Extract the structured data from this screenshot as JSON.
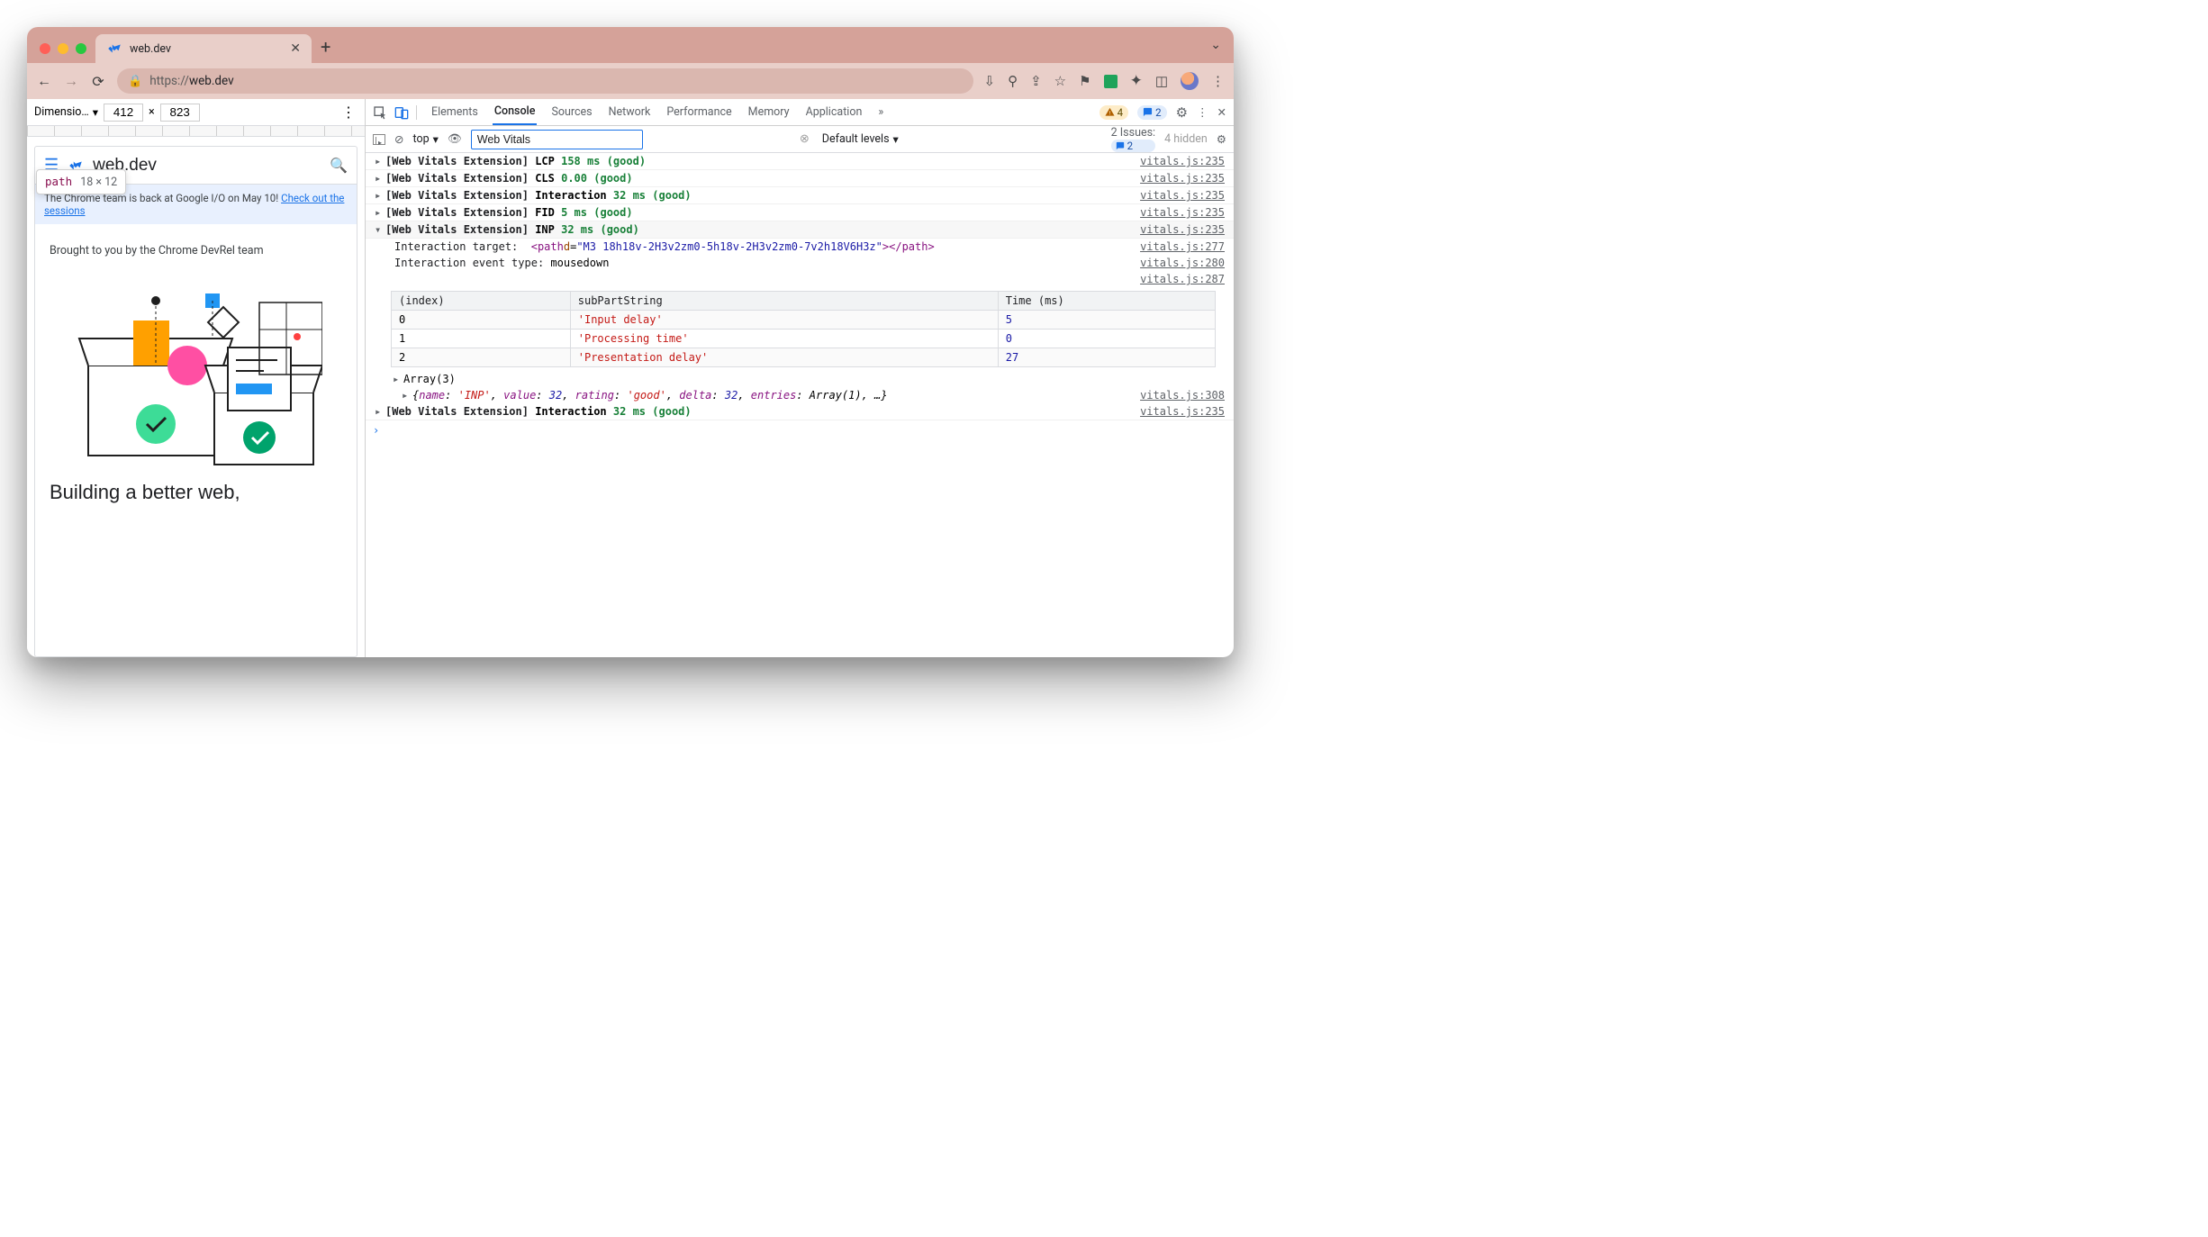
{
  "browser": {
    "tab_title": "web.dev",
    "url_proto": "https://",
    "url_host": "web.dev",
    "address_display": "https://web.dev"
  },
  "device_bar": {
    "label": "Dimensio…",
    "width": "412",
    "sep": "×",
    "height": "823"
  },
  "tooltip": {
    "tag": "path",
    "dims": "18 × 12"
  },
  "page": {
    "site_name": "web.dev",
    "banner_text": "The Chrome team is back at Google I/O on May 10! ",
    "banner_link": "Check out the sessions",
    "brought": "Brought to you by the Chrome DevRel team",
    "headline": "Building a better web,"
  },
  "devtools": {
    "tabs": [
      "Elements",
      "Console",
      "Sources",
      "Network",
      "Performance",
      "Memory",
      "Application"
    ],
    "selected_tab": "Console",
    "more_tabs": "»",
    "warn_count": "4",
    "info_count": "2",
    "console_toolbar": {
      "context": "top",
      "filter": "Web Vitals",
      "levels": "Default levels",
      "issues_label": "2 Issues:",
      "issues_count": "2",
      "hidden": "4 hidden"
    },
    "logs": [
      {
        "prefix": "[Web Vitals Extension]",
        "metric": "LCP",
        "value": "158 ms",
        "rating": "(good)",
        "loc": "vitals.js:235",
        "expanded": false
      },
      {
        "prefix": "[Web Vitals Extension]",
        "metric": "CLS",
        "value": "0.00",
        "rating": "(good)",
        "loc": "vitals.js:235",
        "expanded": false
      },
      {
        "prefix": "[Web Vitals Extension]",
        "metric": "Interaction",
        "value": "32 ms",
        "rating": "(good)",
        "loc": "vitals.js:235",
        "expanded": false
      },
      {
        "prefix": "[Web Vitals Extension]",
        "metric": "FID",
        "value": "5 ms",
        "rating": "(good)",
        "loc": "vitals.js:235",
        "expanded": false
      },
      {
        "prefix": "[Web Vitals Extension]",
        "metric": "INP",
        "value": "32 ms",
        "rating": "(good)",
        "loc": "vitals.js:235",
        "expanded": true
      },
      {
        "prefix": "[Web Vitals Extension]",
        "metric": "Interaction",
        "value": "32 ms",
        "rating": "(good)",
        "loc": "vitals.js:235",
        "expanded": false
      }
    ],
    "inp_detail": {
      "target_label": "Interaction target:",
      "target_html_open": "<path ",
      "target_attr": "d",
      "target_attrv": "\"M3 18h18v-2H3v2zm0-5h18v-2H3v2zm0-7v2h18V6H3z\"",
      "target_html_close": "></path>",
      "target_loc": "vitals.js:277",
      "evtype_label": "Interaction event type:",
      "evtype_value": "mousedown",
      "evtype_loc": "vitals.js:280",
      "table_loc": "vitals.js:287",
      "table_headers": [
        "(index)",
        "subPartString",
        "Time (ms)"
      ],
      "table_rows": [
        {
          "index": "0",
          "sub": "'Input delay'",
          "time": "5"
        },
        {
          "index": "1",
          "sub": "'Processing time'",
          "time": "0"
        },
        {
          "index": "2",
          "sub": "'Presentation delay'",
          "time": "27"
        }
      ],
      "array_label": "Array(3)",
      "object_loc": "vitals.js:308",
      "object_repr": "{name: 'INP', value: 32, rating: 'good', delta: 32, entries: Array(1), …}"
    }
  }
}
